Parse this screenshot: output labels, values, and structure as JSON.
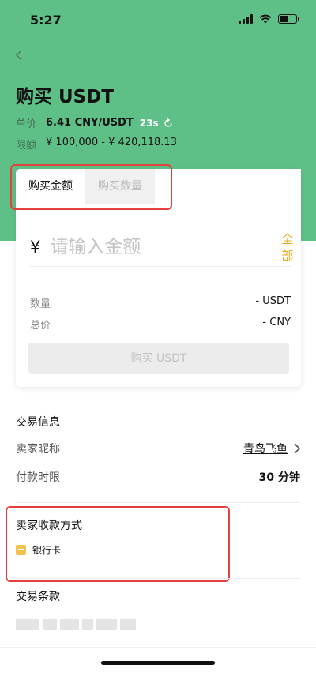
{
  "status_bar": {
    "time": "5:27"
  },
  "header": {
    "title": "购买 USDT",
    "unit_price_label": "单价",
    "unit_price_value": "6.41 CNY/USDT",
    "countdown": "23s",
    "limit_label": "限额",
    "limit_value": "¥ 100,000 - ¥ 420,118.13"
  },
  "card": {
    "tabs": [
      {
        "label": "购买金额"
      },
      {
        "label": "购买数量"
      }
    ],
    "currency_symbol": "¥",
    "amount_placeholder": "请输入金额",
    "all_label": "全部",
    "quantity_label": "数量",
    "quantity_value": "- USDT",
    "total_label": "总价",
    "total_value": "- CNY",
    "buy_button": "购买 USDT"
  },
  "trade_info": {
    "title": "交易信息",
    "seller_label": "卖家昵称",
    "seller_value": "青鸟飞鱼",
    "payment_time_label": "付款时限",
    "payment_time_value": "30 分钟"
  },
  "payment_methods": {
    "title": "卖家收款方式",
    "items": [
      {
        "label": "银行卡"
      }
    ]
  },
  "terms": {
    "title": "交易条款"
  },
  "colors": {
    "header_bg": "#5fc087",
    "accent": "#e8a81b",
    "highlight": "#e4403d"
  }
}
